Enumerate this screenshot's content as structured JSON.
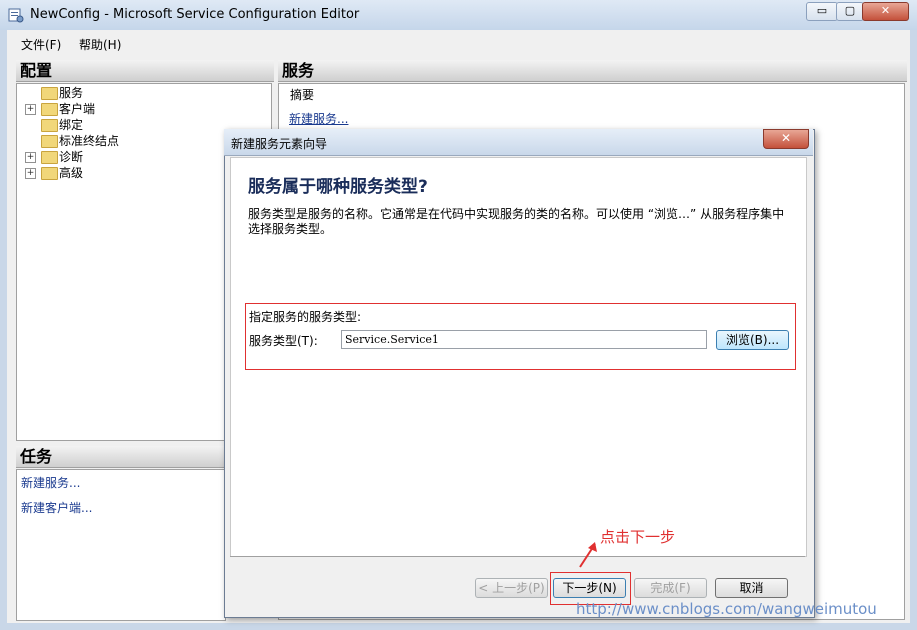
{
  "window": {
    "title": "NewConfig - Microsoft Service Configuration Editor",
    "minimize_glyph": "▭",
    "maximize_glyph": "▢",
    "close_glyph": "✕"
  },
  "menubar": {
    "file": "文件(F)",
    "help": "帮助(H)"
  },
  "config_pane": {
    "title": "配置",
    "tree": [
      {
        "label": "服务",
        "expander": ""
      },
      {
        "label": "客户端",
        "expander": "+"
      },
      {
        "label": "绑定",
        "expander": ""
      },
      {
        "label": "标准终结点",
        "expander": ""
      },
      {
        "label": "诊断",
        "expander": "+"
      },
      {
        "label": "高级",
        "expander": "+"
      }
    ]
  },
  "tasks_pane": {
    "title": "任务",
    "links": [
      "新建服务...",
      "新建客户端..."
    ]
  },
  "services_pane": {
    "title": "服务",
    "summary": "摘要",
    "new_service_link": "新建服务..."
  },
  "dialog": {
    "title": "新建服务元素向导",
    "close_glyph": "✕",
    "heading": "服务属于哪种服务类型?",
    "description": "服务类型是服务的名称。它通常是在代码中实现服务的类的名称。可以使用 “浏览…” 从服务程序集中选择服务类型。",
    "spec_label": "指定服务的服务类型:",
    "type_label": "服务类型(T):",
    "type_value": "Service.Service1",
    "browse_button": "浏览(B)...",
    "prev_button": "< 上一步(P)",
    "next_button": "下一步(N)",
    "finish_button": "完成(F)",
    "cancel_button": "取消"
  },
  "annotation": {
    "text": "点击下一步",
    "color": "#e03030"
  },
  "watermark": "http://www.cnblogs.com/wangweimutou"
}
